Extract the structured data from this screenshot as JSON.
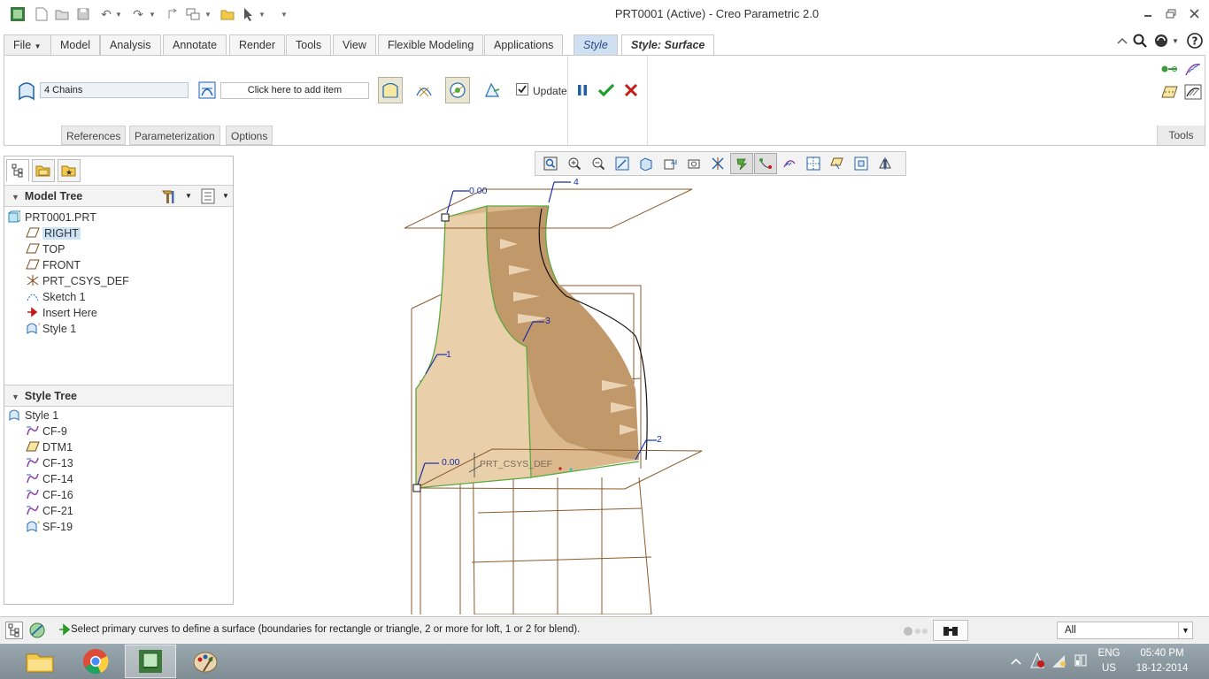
{
  "window": {
    "title": "PRT0001 (Active) - Creo Parametric 2.0"
  },
  "ribbon_tabs": [
    "File",
    "Model",
    "Analysis",
    "Annotate",
    "Render",
    "Tools",
    "View",
    "Flexible Modeling",
    "Applications",
    "Style",
    "Style: Surface"
  ],
  "ribbon": {
    "chains_field": "4 Chains",
    "add_item_field": "Click here to add item",
    "update_label": "Update",
    "update_checked": true,
    "subtabs": [
      "References",
      "Parameterization",
      "Options"
    ],
    "tools_label": "Tools"
  },
  "model_tree": {
    "header": "Model Tree",
    "items": [
      {
        "label": "PRT0001.PRT",
        "icon": "part-icon"
      },
      {
        "label": "RIGHT",
        "icon": "datum-plane-icon",
        "selected": true
      },
      {
        "label": "TOP",
        "icon": "datum-plane-icon"
      },
      {
        "label": "FRONT",
        "icon": "datum-plane-icon"
      },
      {
        "label": "PRT_CSYS_DEF",
        "icon": "csys-icon"
      },
      {
        "label": "Sketch 1",
        "icon": "sketch-icon"
      },
      {
        "label": "Insert Here",
        "icon": "insert-arrow-icon"
      },
      {
        "label": "Style 1",
        "icon": "style-icon"
      }
    ]
  },
  "style_tree": {
    "header": "Style Tree",
    "items": [
      {
        "label": "Style 1",
        "icon": "style-icon"
      },
      {
        "label": "CF-9",
        "icon": "curve-icon"
      },
      {
        "label": "DTM1",
        "icon": "datum-plane-icon"
      },
      {
        "label": "CF-13",
        "icon": "curve-icon"
      },
      {
        "label": "CF-14",
        "icon": "curve-icon"
      },
      {
        "label": "CF-16",
        "icon": "curve-icon"
      },
      {
        "label": "CF-21",
        "icon": "curve-icon"
      },
      {
        "label": "SF-19",
        "icon": "style-surface-icon"
      }
    ]
  },
  "viewport": {
    "labels": {
      "top_value": "0.00",
      "bottom_value": "0.00",
      "chain1": "1",
      "chain2": "2",
      "chain3": "3",
      "chain4": "4",
      "csys": "PRT_CSYS_DEF"
    }
  },
  "status": {
    "message": "Select primary curves to define a surface (boundaries for rectangle or triangle, 2 or more for loft, 1 or 2 for blend).",
    "filter": "All"
  },
  "taskbar": {
    "language": "ENG",
    "region": "US",
    "time": "05:40 PM",
    "date": "18-12-2014"
  },
  "colors": {
    "surface_fill": "#d9b58a",
    "surface_edge": "#5aa83c",
    "wire": "#8a5a2c",
    "selection": "#cde3f7",
    "accept_green": "#1f9e2c",
    "cancel_red": "#c21b1b"
  }
}
